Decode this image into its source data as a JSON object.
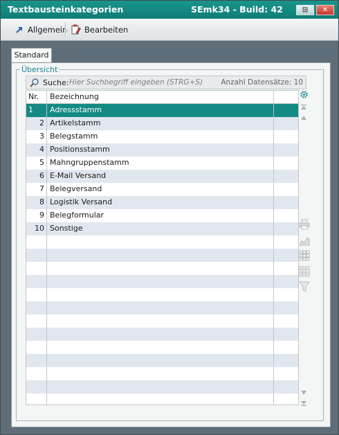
{
  "window": {
    "title": "Textbausteinkategorien",
    "build": "SEmk34 - Build: 42",
    "minimize_glyph": "⊡",
    "close_glyph": "✕"
  },
  "toolbar": {
    "allgemein": "Allgemein",
    "bearbeiten": "Bearbeiten"
  },
  "tabs": [
    {
      "label": "Standard"
    }
  ],
  "group": {
    "label": "Übersicht"
  },
  "search": {
    "label": "Suche:",
    "placeholder": "Hier Suchbegriff eingeben (STRG+S)",
    "count_label": "Anzahl Datensätze: 10"
  },
  "grid": {
    "headers": {
      "nr": "Nr.",
      "bezeichnung": "Bezeichnung"
    },
    "rows": [
      {
        "nr": "1",
        "bezeichnung": "Adressstamm",
        "selected": true
      },
      {
        "nr": "2",
        "bezeichnung": "Artikelstamm"
      },
      {
        "nr": "3",
        "bezeichnung": "Belegstamm"
      },
      {
        "nr": "4",
        "bezeichnung": "Positionsstamm"
      },
      {
        "nr": "5",
        "bezeichnung": "Mahngruppenstamm"
      },
      {
        "nr": "6",
        "bezeichnung": "E-Mail Versand"
      },
      {
        "nr": "7",
        "bezeichnung": "Belegversand"
      },
      {
        "nr": "8",
        "bezeichnung": "Logistik Versand"
      },
      {
        "nr": "9",
        "bezeichnung": "Belegformular"
      },
      {
        "nr": "10",
        "bezeichnung": "Sonstige"
      }
    ]
  },
  "colors": {
    "titlebar": "#148a84",
    "selected_row": "#148a84",
    "alt_row": "#e1e7ef",
    "group_label": "#1a7f97"
  },
  "icons": {
    "allgemein": "arrow-up-right-icon",
    "bearbeiten": "document-edit-icon",
    "search": "magnifier-icon",
    "settings": "gear-icon",
    "first": "first-record-icon",
    "prev": "previous-record-icon",
    "print": "printer-icon",
    "chart": "chart-icon",
    "select_all": "select-all-icon",
    "columns": "grid-columns-icon",
    "filter": "filter-icon",
    "next": "next-record-icon",
    "last": "last-record-icon"
  }
}
